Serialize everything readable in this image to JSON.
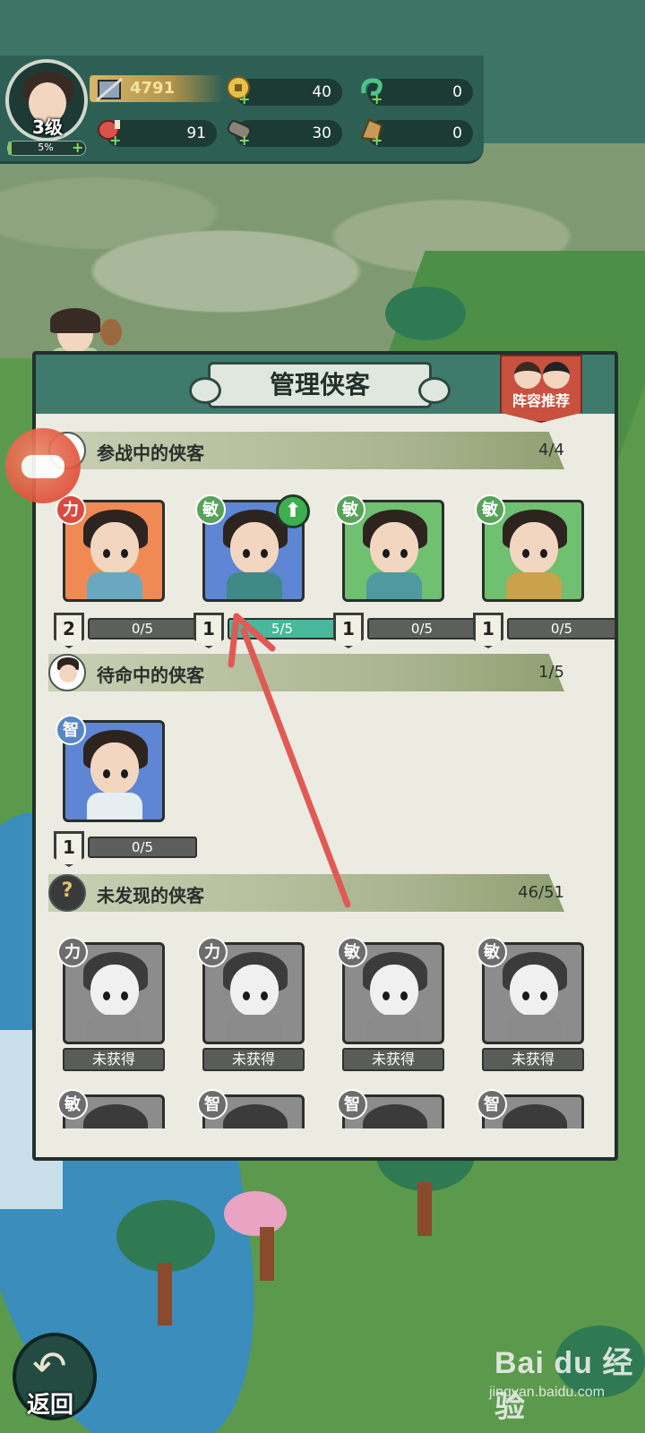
{
  "hud": {
    "level": "3级",
    "exp_percent_text": "5%",
    "exp_fraction": 0.05,
    "power": "4791",
    "coins": "40",
    "jade": "0",
    "meat": "91",
    "wood": "30",
    "ore": "0"
  },
  "panel": {
    "title": "管理侠客",
    "recommend_label": "阵容推荐",
    "sections": {
      "active": {
        "label": "参战中的侠客",
        "count": "4/4"
      },
      "standby": {
        "label": "待命中的侠客",
        "count": "1/5"
      },
      "undiscovered": {
        "label": "未发现的侠客",
        "count": "46/51"
      }
    },
    "active_heroes": [
      {
        "attr": "力",
        "stars": "2",
        "fragments": "0/5",
        "upgrade": false,
        "bg": "#f08a55",
        "robe": "#6aa7c0"
      },
      {
        "attr": "敏",
        "stars": "1",
        "fragments": "5/5",
        "upgrade": true,
        "bg": "#5f86d4",
        "robe": "#3f8a86"
      },
      {
        "attr": "敏",
        "stars": "1",
        "fragments": "0/5",
        "upgrade": false,
        "bg": "#6fc070",
        "robe": "#4e9aa0"
      },
      {
        "attr": "敏",
        "stars": "1",
        "fragments": "0/5",
        "upgrade": false,
        "bg": "#6fc070",
        "robe": "#c9a24a"
      }
    ],
    "standby_heroes": [
      {
        "attr": "智",
        "stars": "1",
        "fragments": "0/5",
        "bg": "#5f86d4",
        "robe": "#e6eef2"
      }
    ],
    "undiscovered_heroes": [
      {
        "attr": "力",
        "status": "未获得"
      },
      {
        "attr": "力",
        "status": "未获得"
      },
      {
        "attr": "敏",
        "status": "未获得"
      },
      {
        "attr": "敏",
        "status": "未获得"
      }
    ],
    "partial_row_attrs": [
      "敏",
      "智",
      "智",
      "智"
    ]
  },
  "back_label": "返回",
  "watermark": {
    "brand": "Bai du 经验",
    "url": "jingyan.baidu.com"
  },
  "colors": {
    "annotation_arrow": "#e05a55",
    "panel_header": "#3f7b6c",
    "recommend_bg": "#c8513f"
  }
}
